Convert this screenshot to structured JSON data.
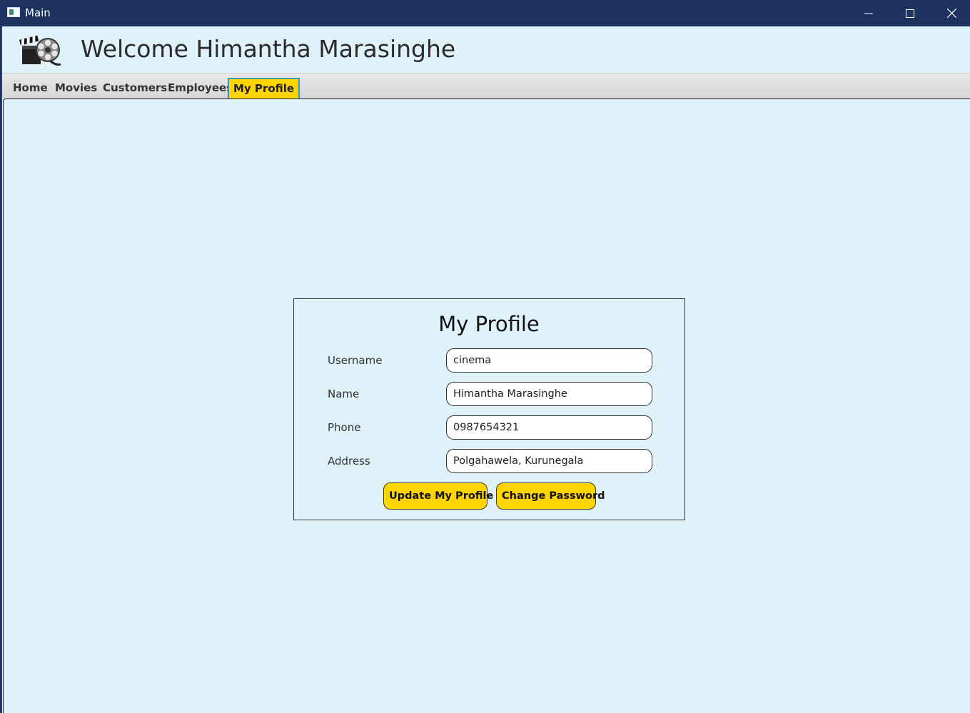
{
  "window": {
    "title": "Main",
    "controls": [
      "minimize-icon",
      "maximize-icon",
      "close-icon"
    ]
  },
  "header": {
    "logo_icon": "film-reel-clapperboard-icon",
    "welcome_text": "Welcome Himantha Marasinghe"
  },
  "tabs": [
    {
      "label": "Home",
      "active": false
    },
    {
      "label": "Movies",
      "active": false
    },
    {
      "label": "Customers",
      "active": false
    },
    {
      "label": "Employees",
      "active": false
    },
    {
      "label": "My Profile",
      "active": true
    }
  ],
  "profile": {
    "title": "My Profile",
    "fields": [
      {
        "label": "Username",
        "value": "cinema"
      },
      {
        "label": "Name",
        "value": "Himantha Marasinghe"
      },
      {
        "label": "Phone",
        "value": "0987654321"
      },
      {
        "label": "Address",
        "value": "Polgahawela, Kurunegala"
      }
    ],
    "update_button": "Update My Profile",
    "change_password_button": "Change Password"
  },
  "colors": {
    "titlebar": "#1d3260",
    "background": "#dff1f9",
    "accent": "#ffd500",
    "tab_active_border": "#3a9ab5"
  }
}
